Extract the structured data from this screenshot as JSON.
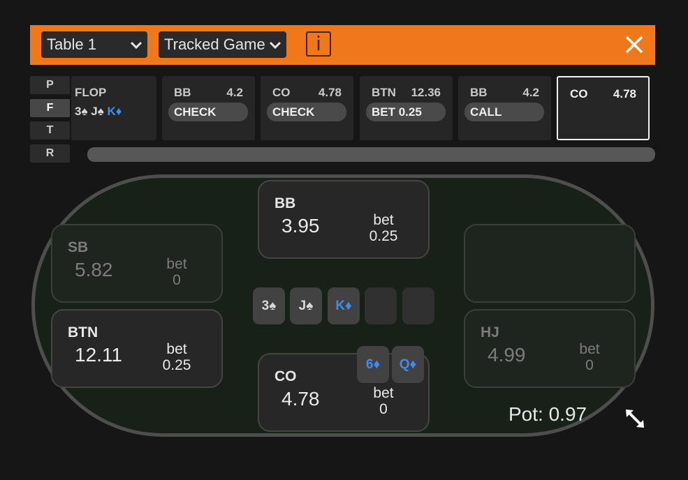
{
  "header": {
    "table_select": "Table 1",
    "game_select": "Tracked Game",
    "info_label": "i"
  },
  "streets": [
    "P",
    "F",
    "T",
    "R"
  ],
  "history": {
    "flop_label": "FLOP",
    "flop_cards": [
      {
        "rank": "3",
        "suit": "♠"
      },
      {
        "rank": "J",
        "suit": "♠"
      },
      {
        "rank": "K",
        "suit": "♦"
      }
    ],
    "actions": [
      {
        "pos": "BB",
        "stack": "4.2",
        "action": "CHECK"
      },
      {
        "pos": "CO",
        "stack": "4.78",
        "action": "CHECK"
      },
      {
        "pos": "BTN",
        "stack": "12.36",
        "action": "BET 0.25"
      },
      {
        "pos": "BB",
        "stack": "4.2",
        "action": "CALL"
      },
      {
        "pos": "CO",
        "stack": "4.78",
        "action": ""
      }
    ]
  },
  "seats": {
    "bb": {
      "name": "BB",
      "stack": "3.95",
      "bet_label": "bet",
      "bet": "0.25"
    },
    "sb": {
      "name": "SB",
      "stack": "5.82",
      "bet_label": "bet",
      "bet": "0"
    },
    "btn": {
      "name": "BTN",
      "stack": "12.11",
      "bet_label": "bet",
      "bet": "0.25"
    },
    "co": {
      "name": "CO",
      "stack": "4.78",
      "bet_label": "bet",
      "bet": "0"
    },
    "hj": {
      "name": "HJ",
      "stack": "4.99",
      "bet_label": "bet",
      "bet": "0"
    }
  },
  "board": [
    {
      "rank": "3",
      "suit": "♠"
    },
    {
      "rank": "J",
      "suit": "♠"
    },
    {
      "rank": "K",
      "suit": "♦"
    }
  ],
  "hero_cards": [
    {
      "rank": "6",
      "suit": "♦"
    },
    {
      "rank": "Q",
      "suit": "♦"
    }
  ],
  "pot": "Pot: 0.97",
  "colors": {
    "accent": "#f07818",
    "diamond": "#3f8cf0",
    "felt": "#172117"
  }
}
